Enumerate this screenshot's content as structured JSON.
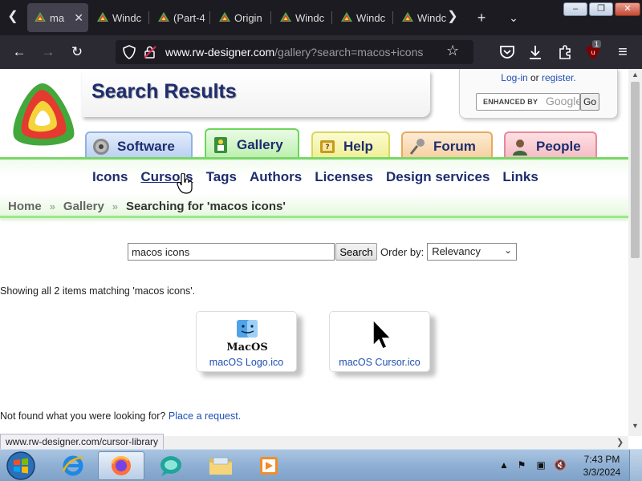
{
  "browser": {
    "tabs": [
      {
        "label": "ma",
        "active": true
      },
      {
        "label": "Windc",
        "active": false
      },
      {
        "label": "(Part-4",
        "active": false
      },
      {
        "label": "Origin",
        "active": false
      },
      {
        "label": "Windc",
        "active": false
      },
      {
        "label": "Windc",
        "active": false
      },
      {
        "label": "Windc",
        "active": false
      }
    ],
    "url_host": "www.rw-designer.com",
    "url_path": "/gallery?search=macos+icons",
    "extension_badge": "1",
    "window_controls": {
      "minimize": "–",
      "maximize": "❐",
      "close": "✕"
    }
  },
  "header": {
    "title": "Search Results",
    "login_text": "Log-in",
    "or_text": "or",
    "register_text": "register.",
    "google_enhanced_label": "ENHANCED BY",
    "google_label": "Google",
    "google_go": "Go"
  },
  "main_tabs": [
    {
      "label": "Software"
    },
    {
      "label": "Gallery"
    },
    {
      "label": "Help"
    },
    {
      "label": "Forum"
    },
    {
      "label": "People"
    }
  ],
  "subnav": {
    "links": [
      "Icons",
      "Cursors",
      "Tags",
      "Authors",
      "Licenses",
      "Design services",
      "Links"
    ]
  },
  "breadcrumb": {
    "home": "Home",
    "gallery": "Gallery",
    "current": "Searching for 'macos icons'"
  },
  "search": {
    "value": "macos icons",
    "button": "Search",
    "order_label": "Order by:",
    "order_value": "Relevancy"
  },
  "results": {
    "info": "Showing all 2 items matching 'macos icons'.",
    "items": [
      {
        "name": "macOS Logo.ico",
        "art_text": "MacOS"
      },
      {
        "name": "macOS Cursor.ico"
      }
    ]
  },
  "not_found": {
    "text": "Not found what you were looking for?",
    "link": "Place a request."
  },
  "status_tooltip": "www.rw-designer.com/cursor-library",
  "taskbar": {
    "time": "7:43 PM",
    "date": "3/3/2024"
  }
}
